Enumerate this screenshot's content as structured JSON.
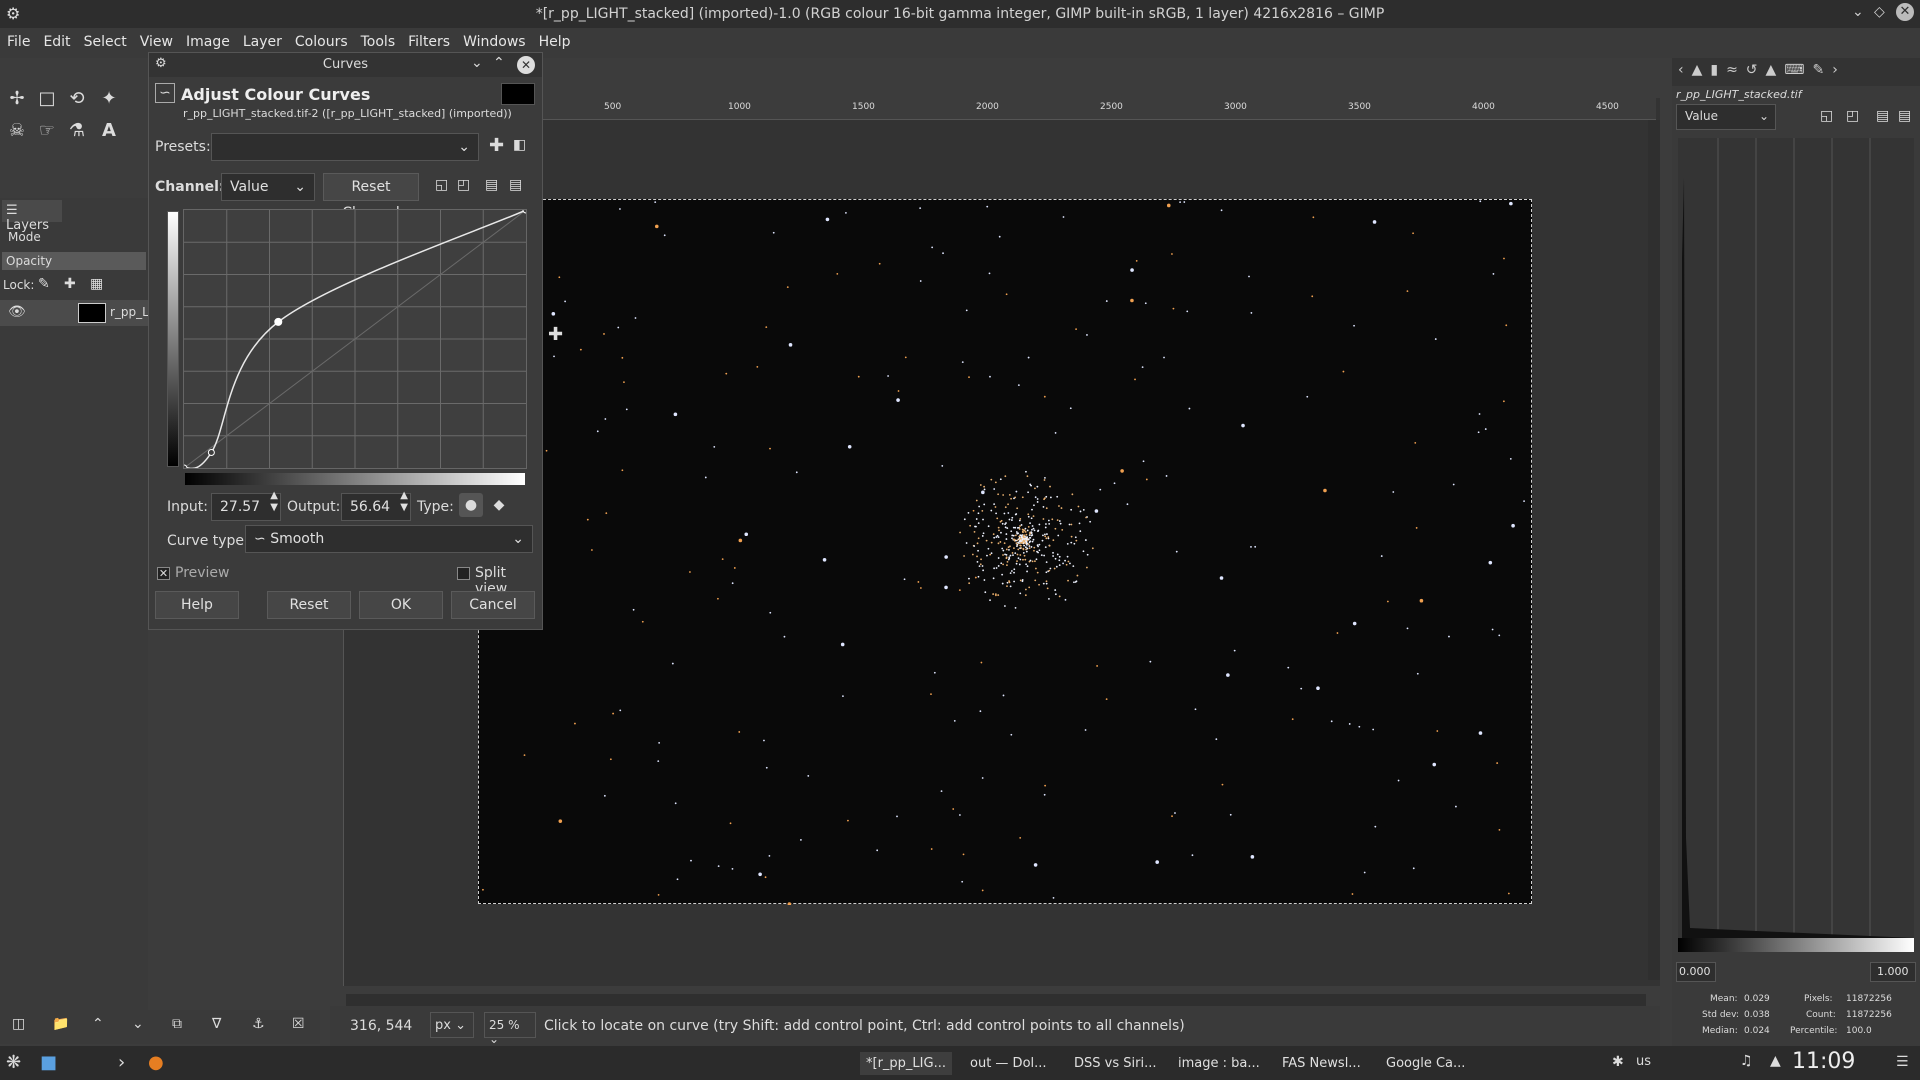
{
  "window": {
    "title": "*[r_pp_LIGHT_stacked] (imported)-1.0 (RGB colour 16-bit gamma integer, GIMP built-in sRGB, 1 layer) 4216x2816 – GIMP"
  },
  "menu": [
    "File",
    "Edit",
    "Select",
    "View",
    "Image",
    "Layer",
    "Colours",
    "Tools",
    "Filters",
    "Windows",
    "Help"
  ],
  "layers_panel": {
    "tab": "Layers",
    "mode_label": "Mode",
    "opacity_label": "Opacity",
    "lock_label": "Lock:",
    "layer_name": "r_pp_L"
  },
  "ruler": {
    "top_ticks": [
      "500",
      "1000",
      "1500",
      "2000",
      "2500",
      "3000",
      "3500",
      "4000",
      "4500"
    ]
  },
  "dialog": {
    "title": "Curves",
    "heading": "Adjust Colour Curves",
    "subheading": "r_pp_LIGHT_stacked.tif-2 ([r_pp_LIGHT_stacked] (imported))",
    "presets_label": "Presets:",
    "presets_value": "",
    "channel_label": "Channel:",
    "channel_value": "Value",
    "reset_channel": "Reset Channel",
    "input_label": "Input:",
    "input_value": "27.57",
    "output_label": "Output:",
    "output_value": "56.64",
    "type_label": "Type:",
    "curve_type_label": "Curve type:",
    "curve_type_value": "Smooth",
    "preview_label": "Preview",
    "preview_checked": true,
    "split_view_label": "Split view",
    "buttons": {
      "help": "Help",
      "reset": "Reset",
      "ok": "OK",
      "cancel": "Cancel"
    }
  },
  "curve_points": [
    [
      0,
      0
    ],
    [
      8,
      6
    ],
    [
      27.57,
      56.64
    ],
    [
      100,
      100
    ]
  ],
  "status": {
    "coords": "316, 544",
    "unit": "px",
    "zoom": "25 %",
    "message": "Click to locate on curve (try Shift: add control point, Ctrl: add control points to all channels)"
  },
  "right_panel": {
    "image_name": "r_pp_LIGHT_stacked.tif",
    "channel": "Value",
    "range_low": "0.000",
    "range_high": "1.000",
    "stats": {
      "mean_label": "Mean:",
      "mean": "0.029",
      "stddev_label": "Std dev:",
      "stddev": "0.038",
      "median_label": "Median:",
      "median": "0.024",
      "pixels_label": "Pixels:",
      "pixels": "11872256",
      "count_label": "Count:",
      "count": "11872256",
      "percentile_label": "Percentile:",
      "percentile": "100.0"
    }
  },
  "taskbar": {
    "tasks": [
      "*[r_pp_LIG...",
      "out — Dol...",
      "DSS vs Siri...",
      "image : ba...",
      "FAS Newsl...",
      "Google Ca..."
    ],
    "locale": "us",
    "clock": "11:09"
  },
  "colors": {
    "accent": "#5a5a5a",
    "canvas_bg": "#333333",
    "image_bg": "#090909"
  }
}
